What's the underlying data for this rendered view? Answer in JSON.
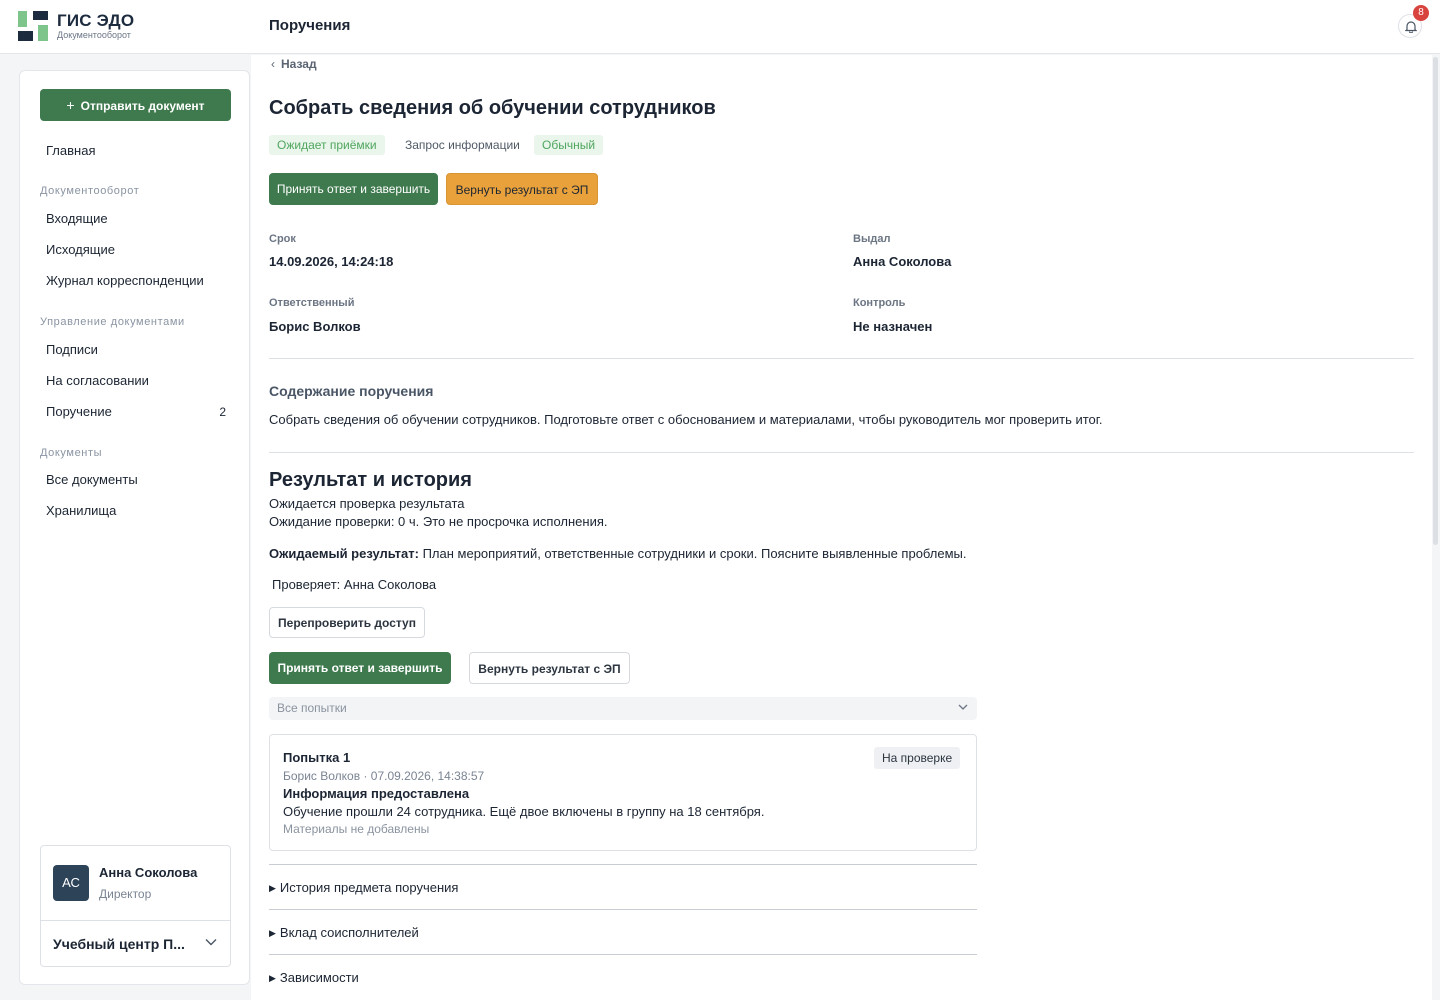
{
  "app": {
    "title": "ГИС ЭДО",
    "subtitle": "Документооборот",
    "page_title": "Поручения",
    "notifications_count": "8"
  },
  "sidebar": {
    "send_button": "Отправить документ",
    "home": "Главная",
    "sections": [
      {
        "title": "Документооборот",
        "items": [
          {
            "label": "Входящие"
          },
          {
            "label": "Исходящие"
          },
          {
            "label": "Журнал корреспонденции"
          }
        ]
      },
      {
        "title": "Управление документами",
        "items": [
          {
            "label": "Подписи"
          },
          {
            "label": "На согласовании"
          },
          {
            "label": "Поручение",
            "badge": "2"
          }
        ]
      },
      {
        "title": "Документы",
        "items": [
          {
            "label": "Все документы"
          },
          {
            "label": "Хранилища"
          }
        ]
      }
    ],
    "user": {
      "initials": "АС",
      "name": "Анна Соколова",
      "role": "Директор",
      "org": "Учебный центр П..."
    }
  },
  "task": {
    "back": "Назад",
    "title": "Собрать сведения об обучении сотрудников",
    "tags": [
      "Ожидает приёмки",
      "Запрос информации",
      "Обычный"
    ],
    "actions": {
      "accept": "Принять ответ и завершить",
      "return": "Вернуть результат с ЭП"
    },
    "meta": {
      "deadline_label": "Срок",
      "deadline": "14.09.2026, 14:24:18",
      "issuer_label": "Выдал",
      "issuer": "Анна Соколова",
      "responsible_label": "Ответственный",
      "responsible": "Борис Волков",
      "control_label": "Контроль",
      "control": "Не назначен"
    },
    "content_title": "Содержание поручения",
    "content_text": "Собрать сведения об обучении сотрудников. Подготовьте ответ с обоснованием и материалами, чтобы руководитель мог проверить итог."
  },
  "result": {
    "title": "Результат и история",
    "status": "Ожидается проверка результата",
    "waiting": "Ожидание проверки: 0 ч. Это не просрочка исполнения.",
    "expected_label": "Ожидаемый результат:",
    "expected_text": "План мероприятий, ответственные сотрудники и сроки. Поясните выявленные проблемы.",
    "reviewer": "Проверяет: Анна Соколова",
    "recheck_button": "Перепроверить доступ",
    "accept_button": "Принять ответ и завершить",
    "return_button": "Вернуть результат с ЭП",
    "filter_value": "Все попытки",
    "attempt": {
      "title": "Попытка 1",
      "badge": "На проверке",
      "meta": "Борис Волков · 07.09.2026, 14:38:57",
      "heading": "Информация предоставлена",
      "text": "Обучение прошли 24 сотрудника. Ещё двое включены в группу на 18 сентября.",
      "materials": "Материалы не добавлены"
    },
    "accordions": [
      "История предмета поручения",
      "Вклад соисполнителей",
      "Зависимости"
    ]
  }
}
